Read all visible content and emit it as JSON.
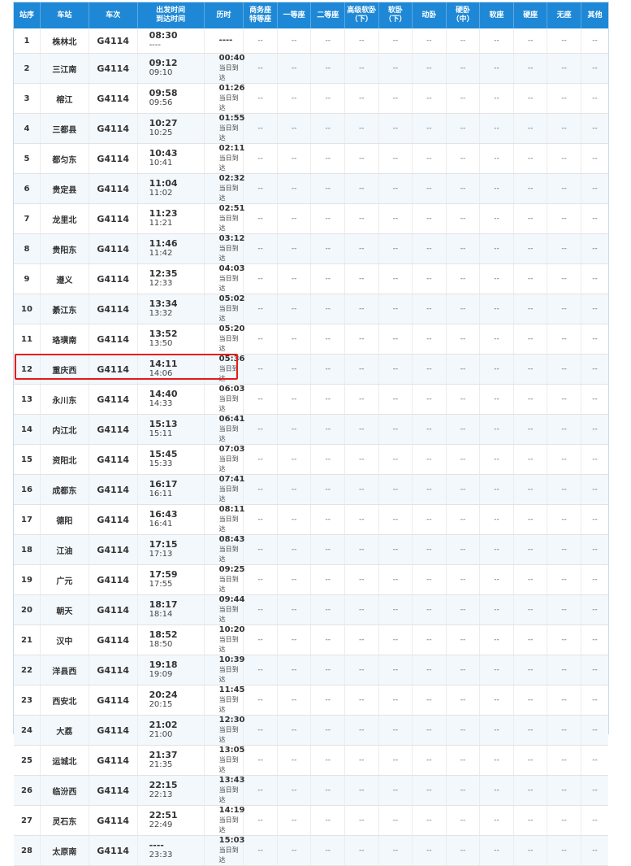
{
  "headers": [
    "站序",
    "车站",
    "车次",
    "出发时间\n到达时间",
    "历时",
    "商务座\n特等座",
    "一等座",
    "二等座",
    "高级软卧\n（下）",
    "软卧\n（下）",
    "动卧",
    "硬卧\n（中）",
    "软座",
    "硬座",
    "无座",
    "其他"
  ],
  "seat_placeholder": "--",
  "highlight_color": "#e8191a",
  "header_color": "#1e88d6",
  "rows": [
    {
      "idx": "1",
      "station": "株林北",
      "train": "G4114",
      "dep": "08:30",
      "arr": "----",
      "dur": "----",
      "note": ""
    },
    {
      "idx": "2",
      "station": "三江南",
      "train": "G4114",
      "dep": "09:12",
      "arr": "09:10",
      "dur": "00:40",
      "note": "当日到达"
    },
    {
      "idx": "3",
      "station": "榕江",
      "train": "G4114",
      "dep": "09:58",
      "arr": "09:56",
      "dur": "01:26",
      "note": "当日到达"
    },
    {
      "idx": "4",
      "station": "三都县",
      "train": "G4114",
      "dep": "10:27",
      "arr": "10:25",
      "dur": "01:55",
      "note": "当日到达"
    },
    {
      "idx": "5",
      "station": "都匀东",
      "train": "G4114",
      "dep": "10:43",
      "arr": "10:41",
      "dur": "02:11",
      "note": "当日到达"
    },
    {
      "idx": "6",
      "station": "贵定县",
      "train": "G4114",
      "dep": "11:04",
      "arr": "11:02",
      "dur": "02:32",
      "note": "当日到达"
    },
    {
      "idx": "7",
      "station": "龙里北",
      "train": "G4114",
      "dep": "11:23",
      "arr": "11:21",
      "dur": "02:51",
      "note": "当日到达"
    },
    {
      "idx": "8",
      "station": "贵阳东",
      "train": "G4114",
      "dep": "11:46",
      "arr": "11:42",
      "dur": "03:12",
      "note": "当日到达"
    },
    {
      "idx": "9",
      "station": "遵义",
      "train": "G4114",
      "dep": "12:35",
      "arr": "12:33",
      "dur": "04:03",
      "note": "当日到达"
    },
    {
      "idx": "10",
      "station": "綦江东",
      "train": "G4114",
      "dep": "13:34",
      "arr": "13:32",
      "dur": "05:02",
      "note": "当日到达"
    },
    {
      "idx": "11",
      "station": "珞璜南",
      "train": "G4114",
      "dep": "13:52",
      "arr": "13:50",
      "dur": "05:20",
      "note": "当日到达"
    },
    {
      "idx": "12",
      "station": "重庆西",
      "train": "G4114",
      "dep": "14:11",
      "arr": "14:06",
      "dur": "05:36",
      "note": "当日到达"
    },
    {
      "idx": "13",
      "station": "永川东",
      "train": "G4114",
      "dep": "14:40",
      "arr": "14:33",
      "dur": "06:03",
      "note": "当日到达"
    },
    {
      "idx": "14",
      "station": "内江北",
      "train": "G4114",
      "dep": "15:13",
      "arr": "15:11",
      "dur": "06:41",
      "note": "当日到达"
    },
    {
      "idx": "15",
      "station": "资阳北",
      "train": "G4114",
      "dep": "15:45",
      "arr": "15:33",
      "dur": "07:03",
      "note": "当日到达"
    },
    {
      "idx": "16",
      "station": "成都东",
      "train": "G4114",
      "dep": "16:17",
      "arr": "16:11",
      "dur": "07:41",
      "note": "当日到达"
    },
    {
      "idx": "17",
      "station": "德阳",
      "train": "G4114",
      "dep": "16:43",
      "arr": "16:41",
      "dur": "08:11",
      "note": "当日到达"
    },
    {
      "idx": "18",
      "station": "江油",
      "train": "G4114",
      "dep": "17:15",
      "arr": "17:13",
      "dur": "08:43",
      "note": "当日到达"
    },
    {
      "idx": "19",
      "station": "广元",
      "train": "G4114",
      "dep": "17:59",
      "arr": "17:55",
      "dur": "09:25",
      "note": "当日到达"
    },
    {
      "idx": "20",
      "station": "朝天",
      "train": "G4114",
      "dep": "18:17",
      "arr": "18:14",
      "dur": "09:44",
      "note": "当日到达"
    },
    {
      "idx": "21",
      "station": "汉中",
      "train": "G4114",
      "dep": "18:52",
      "arr": "18:50",
      "dur": "10:20",
      "note": "当日到达"
    },
    {
      "idx": "22",
      "station": "洋县西",
      "train": "G4114",
      "dep": "19:18",
      "arr": "19:09",
      "dur": "10:39",
      "note": "当日到达"
    },
    {
      "idx": "23",
      "station": "西安北",
      "train": "G4114",
      "dep": "20:24",
      "arr": "20:15",
      "dur": "11:45",
      "note": "当日到达"
    },
    {
      "idx": "24",
      "station": "大荔",
      "train": "G4114",
      "dep": "21:02",
      "arr": "21:00",
      "dur": "12:30",
      "note": "当日到达"
    },
    {
      "idx": "25",
      "station": "运城北",
      "train": "G4114",
      "dep": "21:37",
      "arr": "21:35",
      "dur": "13:05",
      "note": "当日到达"
    },
    {
      "idx": "26",
      "station": "临汾西",
      "train": "G4114",
      "dep": "22:15",
      "arr": "22:13",
      "dur": "13:43",
      "note": "当日到达"
    },
    {
      "idx": "27",
      "station": "灵石东",
      "train": "G4114",
      "dep": "22:51",
      "arr": "22:49",
      "dur": "14:19",
      "note": "当日到达"
    },
    {
      "idx": "28",
      "station": "太原南",
      "train": "G4114",
      "dep": "----",
      "arr": "23:33",
      "dur": "15:03",
      "note": "当日到达"
    }
  ]
}
